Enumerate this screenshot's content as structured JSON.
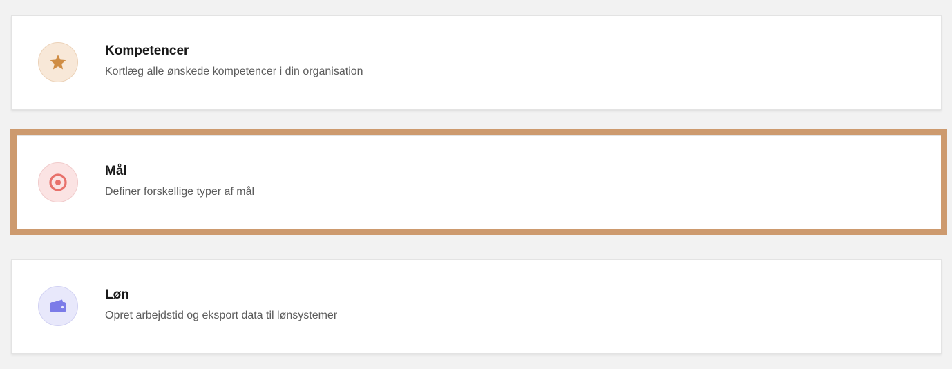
{
  "items": [
    {
      "title": "Kompetencer",
      "description": "Kortlæg alle ønskede kompetencer i din organisation",
      "icon": "star-icon",
      "icon_color": "#cf8d45",
      "icon_bg": "#f8e8d8"
    },
    {
      "title": "Mål",
      "description": "Definer forskellige typer af mål",
      "icon": "target-icon",
      "icon_color": "#e8716b",
      "icon_bg": "#fbe3e3"
    },
    {
      "title": "Løn",
      "description": "Opret arbejdstid og eksport data til lønsystemer",
      "icon": "wallet-icon",
      "icon_color": "#7b7be8",
      "icon_bg": "#e8e8fb"
    }
  ],
  "highlight_color": "#cd9a6e"
}
